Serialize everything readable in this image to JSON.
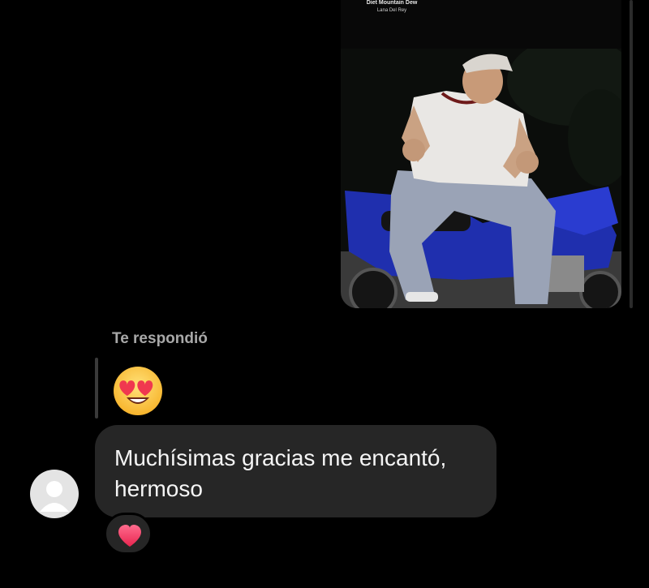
{
  "story": {
    "song_title": "Diet Mountain Dew",
    "song_artist": "Lana Del Rey",
    "photo_label": "story-photo"
  },
  "reply": {
    "label": "Te respondió",
    "quoted_reaction": "heart-eyes-emoji"
  },
  "message": {
    "text_line1": "Muchísimas gracias me encantó,",
    "text_line2": "hermoso",
    "reaction": "red-heart-emoji"
  },
  "colors": {
    "background": "#000000",
    "bubble": "#262626",
    "label_gray": "#a8a8a8",
    "heart_pink": "#ff3b6b"
  }
}
